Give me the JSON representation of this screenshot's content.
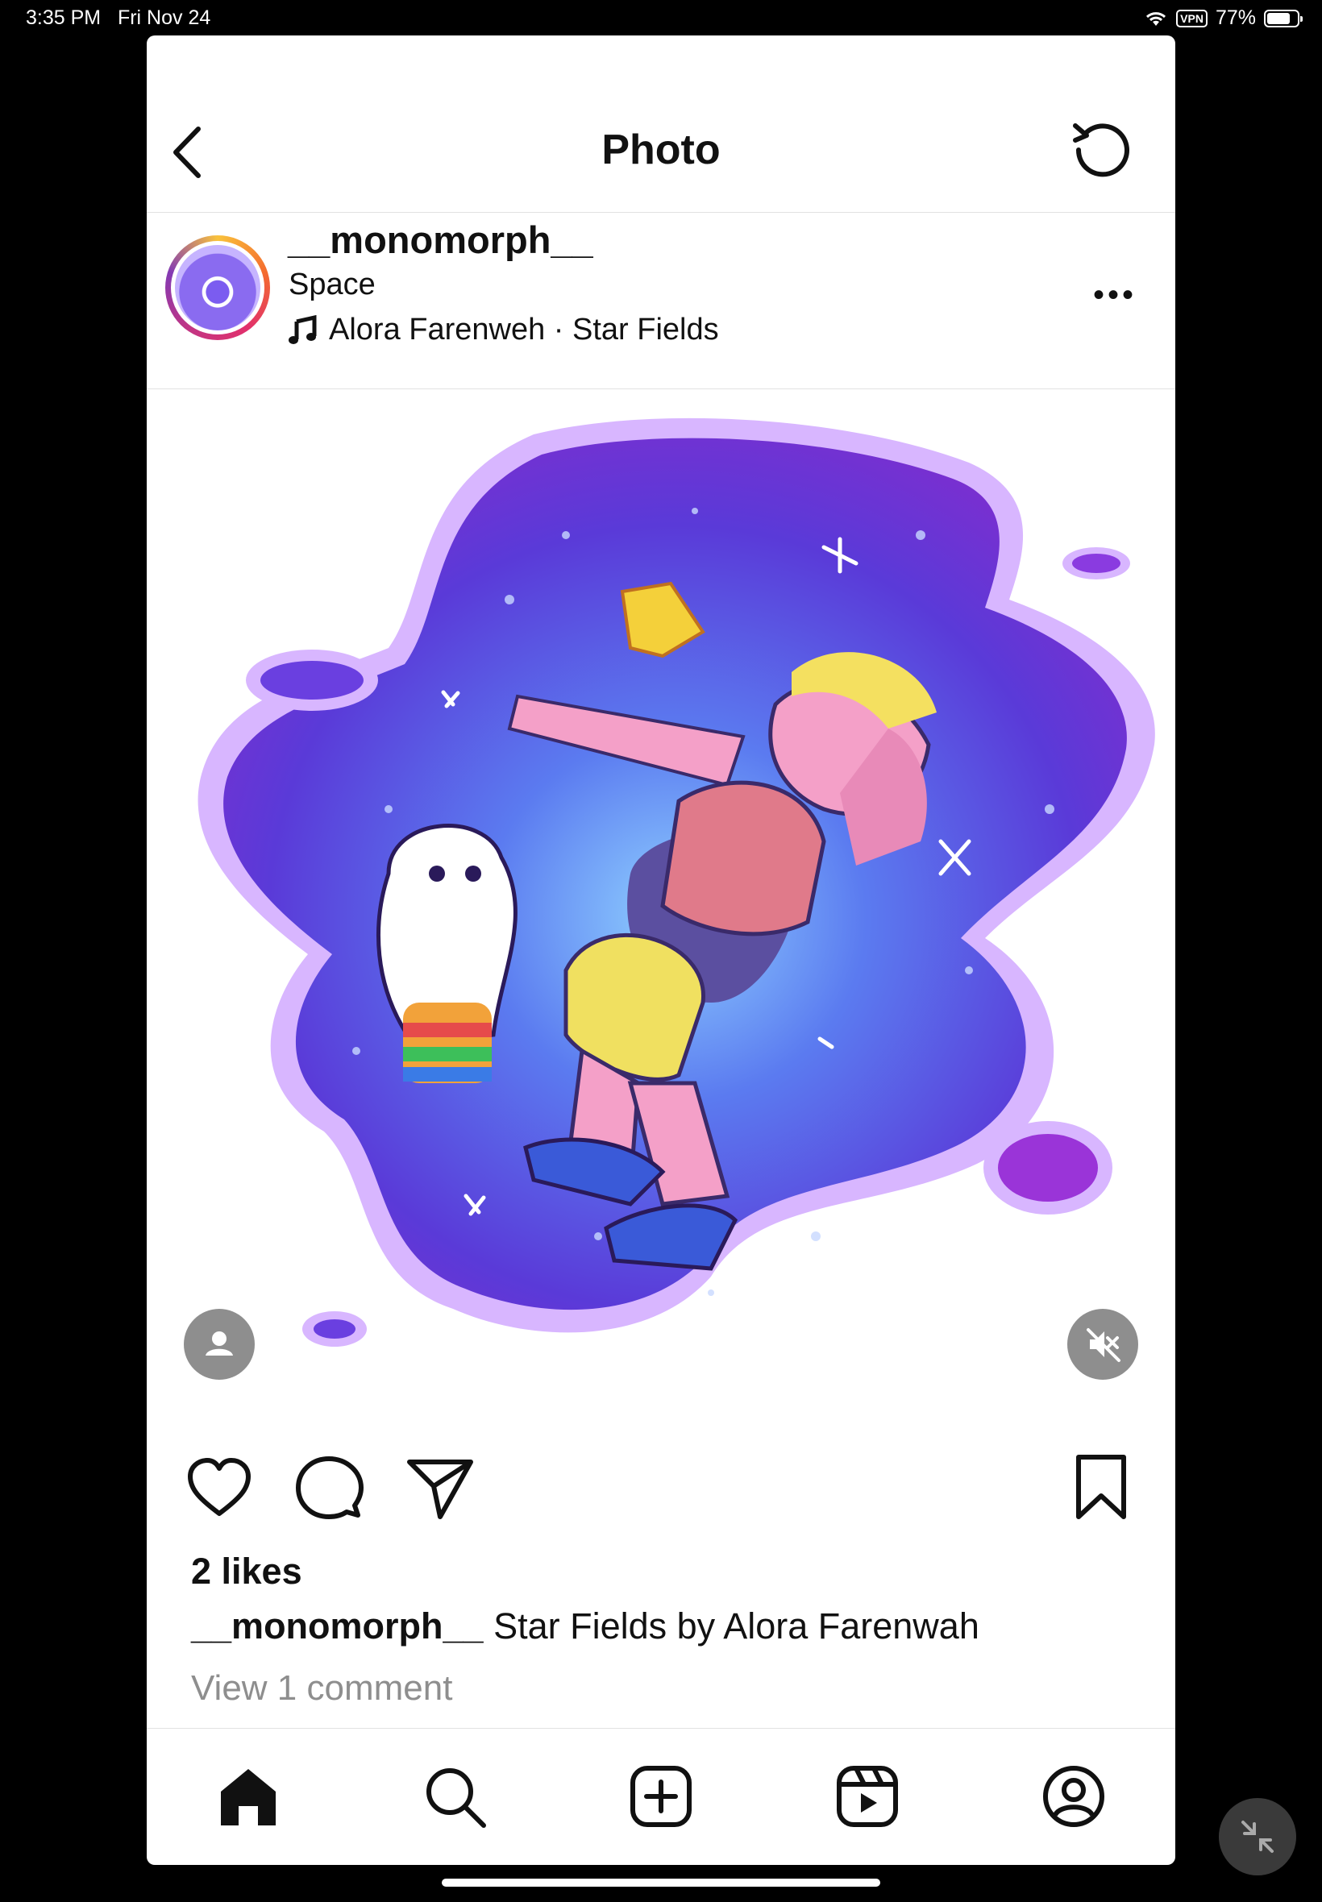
{
  "status_bar": {
    "time": "3:35 PM",
    "date": "Fri Nov 24",
    "vpn": "VPN",
    "battery_text": "77%",
    "battery_level": 0.77
  },
  "header": {
    "title": "Photo",
    "back_icon": "chevron-left-icon",
    "refresh_icon": "refresh-icon"
  },
  "post": {
    "username": "__monomorph__",
    "location": "Space",
    "music": "Alora Farenweh · Star Fields",
    "image_alt": "Illustration of characters floating in a purple starry space blob",
    "likes": "2 likes",
    "caption_user": "__monomorph__",
    "caption_text": " Star Fields by Alora Farenwah",
    "view_comments": "View 1 comment"
  },
  "tabbar": [
    "home-icon",
    "search-icon",
    "create-icon",
    "reels-icon",
    "profile-icon"
  ]
}
